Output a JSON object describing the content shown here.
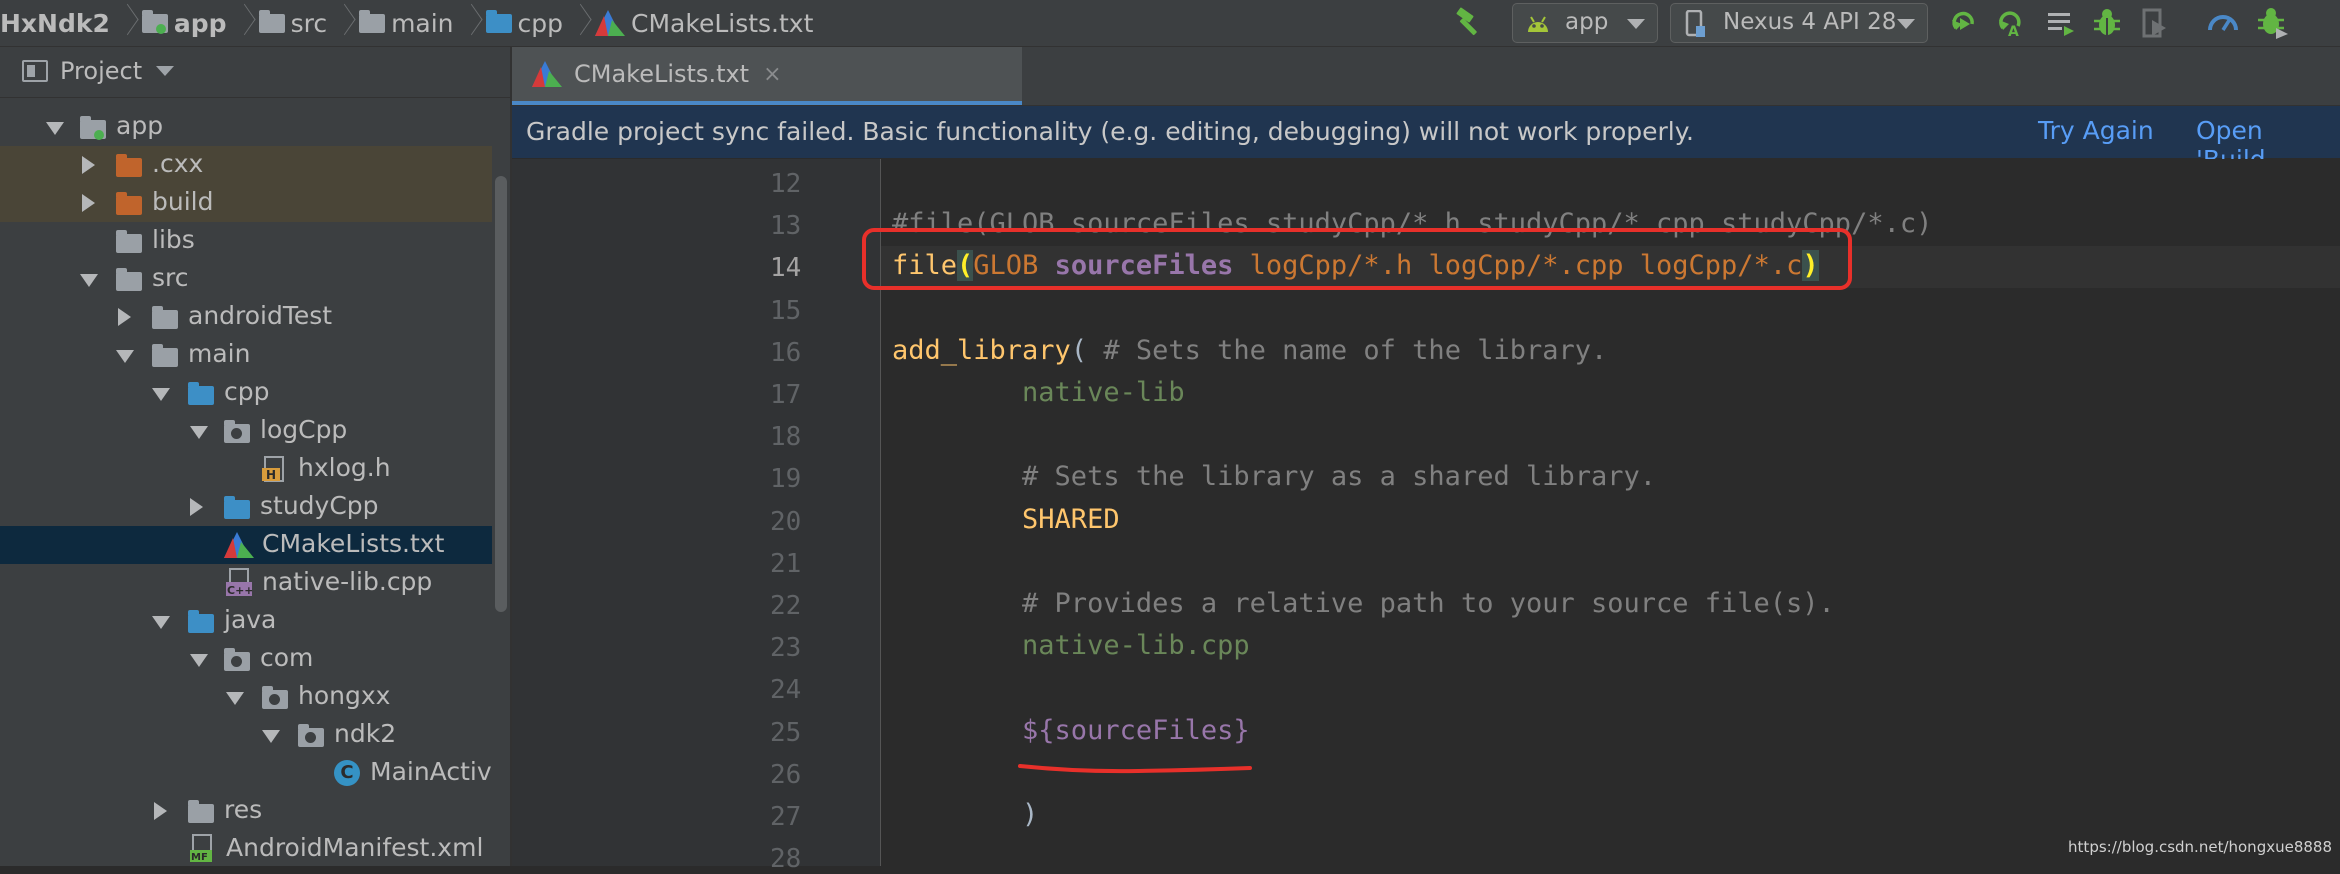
{
  "breadcrumbs": [
    "HxNdk2",
    "app",
    "src",
    "main",
    "cpp",
    "CMakeLists.txt"
  ],
  "toolbar": {
    "run_config": "app",
    "device": "Nexus 4 API 28"
  },
  "project_panel": {
    "title": "Project",
    "tree": [
      {
        "label": "app",
        "level": 0,
        "expanded": true,
        "icon": "module-folder-icon"
      },
      {
        "label": ".cxx",
        "level": 1,
        "expanded": false,
        "icon": "excluded-folder-icon"
      },
      {
        "label": "build",
        "level": 1,
        "expanded": false,
        "icon": "excluded-folder-icon"
      },
      {
        "label": "libs",
        "level": 1,
        "icon": "folder-icon"
      },
      {
        "label": "src",
        "level": 1,
        "expanded": true,
        "icon": "folder-icon"
      },
      {
        "label": "androidTest",
        "level": 2,
        "expanded": false,
        "icon": "folder-icon"
      },
      {
        "label": "main",
        "level": 2,
        "expanded": true,
        "icon": "folder-icon"
      },
      {
        "label": "cpp",
        "level": 3,
        "expanded": true,
        "icon": "source-folder-icon"
      },
      {
        "label": "logCpp",
        "level": 4,
        "expanded": true,
        "icon": "package-folder-icon"
      },
      {
        "label": "hxlog.h",
        "level": 5,
        "icon": "header-file-icon"
      },
      {
        "label": "studyCpp",
        "level": 4,
        "expanded": false,
        "icon": "source-folder-icon"
      },
      {
        "label": "CMakeLists.txt",
        "level": 4,
        "icon": "cmake-icon",
        "selected": true
      },
      {
        "label": "native-lib.cpp",
        "level": 4,
        "icon": "cpp-file-icon"
      },
      {
        "label": "java",
        "level": 3,
        "expanded": true,
        "icon": "source-folder-icon"
      },
      {
        "label": "com",
        "level": 4,
        "expanded": true,
        "icon": "package-folder-icon"
      },
      {
        "label": "hongxx",
        "level": 5,
        "expanded": true,
        "icon": "package-folder-icon"
      },
      {
        "label": "ndk2",
        "level": 6,
        "expanded": true,
        "icon": "package-folder-icon"
      },
      {
        "label": "MainActivity",
        "level": 7,
        "icon": "class-icon"
      },
      {
        "label": "res",
        "level": 3,
        "expanded": false,
        "icon": "resources-folder-icon"
      },
      {
        "label": "AndroidManifest.xml",
        "level": 3,
        "icon": "manifest-file-icon"
      }
    ]
  },
  "editor": {
    "tab_label": "CMakeLists.txt",
    "tab_close": "×",
    "banner": {
      "message": "Gradle project sync failed. Basic functionality (e.g. editing, debugging) will not work properly.",
      "try_again": "Try Again",
      "open_build": "Open 'Build"
    },
    "current_line": 14,
    "lines": [
      {
        "num": "12",
        "segments": []
      },
      {
        "num": "13",
        "segments": [
          {
            "t": "#file(GLOB sourceFiles studyCpp/*.h studyCpp/*.cpp studyCpp/*.c)",
            "c": "c-cmt"
          }
        ]
      },
      {
        "num": "14",
        "segments": [
          {
            "t": "file",
            "c": "c-kw"
          },
          {
            "t": "(",
            "c": "paren"
          },
          {
            "t": "GLOB ",
            "c": "c-const"
          },
          {
            "t": "sourceFiles",
            "c": "c-var c-bold"
          },
          {
            "t": " logCpp/*.h logCpp/*.cpp logCpp/*.c",
            "c": "c-const"
          },
          {
            "t": ")",
            "c": "paren"
          }
        ]
      },
      {
        "num": "15",
        "segments": []
      },
      {
        "num": "16",
        "segments": [
          {
            "t": "add_library",
            "c": "c-kw"
          },
          {
            "t": "( ",
            "c": "c-plain"
          },
          {
            "t": "# Sets the name of the library.",
            "c": "c-cmt"
          }
        ]
      },
      {
        "num": "17",
        "segments": [
          {
            "t": "        native-lib",
            "c": "c-str"
          }
        ]
      },
      {
        "num": "18",
        "segments": []
      },
      {
        "num": "19",
        "segments": [
          {
            "t": "        # Sets the library as a shared library.",
            "c": "c-cmt"
          }
        ]
      },
      {
        "num": "20",
        "segments": [
          {
            "t": "        SHARED",
            "c": "c-kw"
          }
        ]
      },
      {
        "num": "21",
        "segments": []
      },
      {
        "num": "22",
        "segments": [
          {
            "t": "        # Provides a relative path to your source file(s).",
            "c": "c-cmt"
          }
        ]
      },
      {
        "num": "23",
        "segments": [
          {
            "t": "        native-lib.cpp",
            "c": "c-str"
          }
        ]
      },
      {
        "num": "24",
        "segments": []
      },
      {
        "num": "25",
        "segments": [
          {
            "t": "        ${sourceFiles}",
            "c": "c-var"
          }
        ]
      },
      {
        "num": "26",
        "segments": []
      },
      {
        "num": "27",
        "segments": [
          {
            "t": "        )",
            "c": "c-plain"
          }
        ]
      },
      {
        "num": "28",
        "segments": []
      }
    ]
  },
  "watermark": "https://blog.csdn.net/hongxue8888",
  "colors": {
    "highlight_box": "#e8302a",
    "selection": "#0d293e",
    "banner_bg": "#203550",
    "link": "#589df6"
  }
}
